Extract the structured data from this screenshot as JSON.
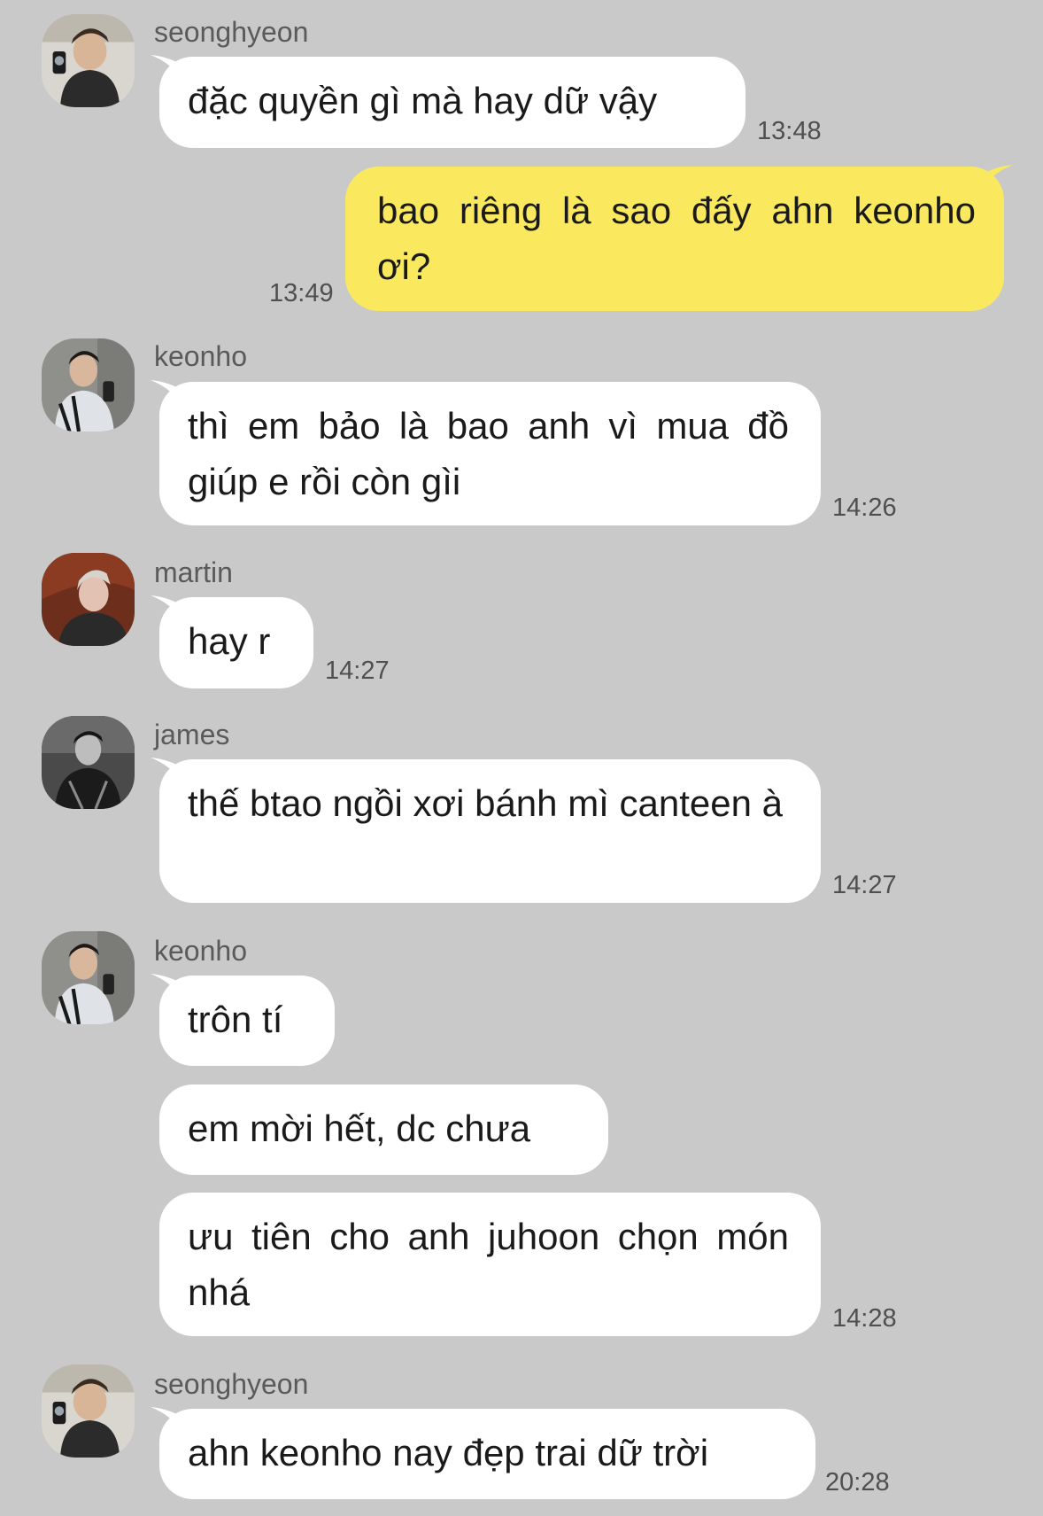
{
  "colors": {
    "background": "#c9c9c9",
    "incoming_bubble": "#ffffff",
    "outgoing_bubble": "#fae95f"
  },
  "messages": [
    {
      "sender": "seonghyeon",
      "avatar": "seonghyeon-avatar",
      "text": "đặc quyền gì mà hay dữ vậy",
      "time": "13:48"
    },
    {
      "sender": "me",
      "text": "bao riêng là sao đấy ahn keonho ơi?",
      "time": "13:49"
    },
    {
      "sender": "keonho",
      "avatar": "keonho-avatar",
      "text": "thì em bảo là bao anh vì mua đồ giúp e rồi còn gìi",
      "time": "14:26"
    },
    {
      "sender": "martin",
      "avatar": "martin-avatar",
      "text": "hay r",
      "time": "14:27"
    },
    {
      "sender": "james",
      "avatar": "james-avatar",
      "text": "thế btao ngồi xơi bánh mì canteen à",
      "time": "14:27"
    },
    {
      "sender": "keonho",
      "avatar": "keonho-avatar",
      "text": "trôn tí"
    },
    {
      "sender": "keonho",
      "text": "em mời hết, dc chưa"
    },
    {
      "sender": "keonho",
      "text": "ưu tiên cho anh juhoon chọn món nhá",
      "time": "14:28"
    },
    {
      "sender": "seonghyeon",
      "avatar": "seonghyeon-avatar",
      "text": "ahn keonho nay đẹp trai dữ trời",
      "time": "20:28"
    }
  ]
}
